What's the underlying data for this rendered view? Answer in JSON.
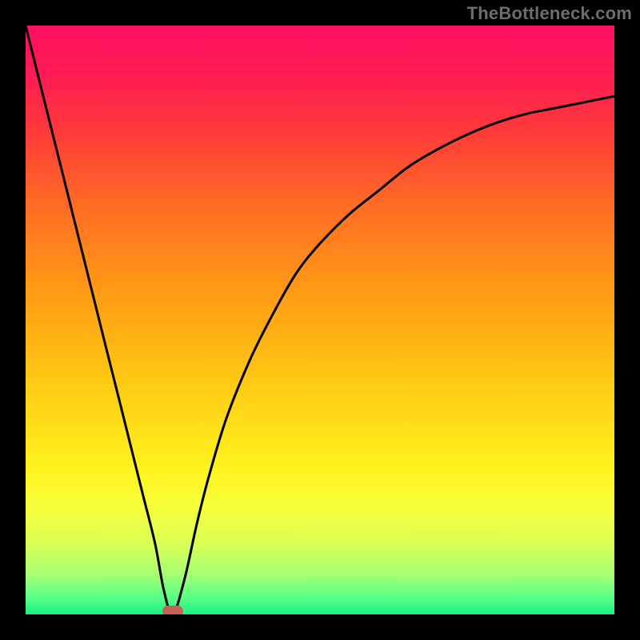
{
  "watermark": "TheBottleneck.com",
  "chart_data": {
    "type": "line",
    "title": "",
    "xlabel": "",
    "ylabel": "",
    "xlim": [
      0,
      100
    ],
    "ylim": [
      0,
      100
    ],
    "legend": false,
    "grid": false,
    "background_gradient_stops": [
      {
        "offset": 0.0,
        "color": "#ff1060"
      },
      {
        "offset": 0.08,
        "color": "#ff1a55"
      },
      {
        "offset": 0.18,
        "color": "#ff3a3a"
      },
      {
        "offset": 0.3,
        "color": "#ff6a25"
      },
      {
        "offset": 0.45,
        "color": "#ff9a15"
      },
      {
        "offset": 0.6,
        "color": "#ffc814"
      },
      {
        "offset": 0.75,
        "color": "#fff21e"
      },
      {
        "offset": 0.82,
        "color": "#f7ff3c"
      },
      {
        "offset": 0.88,
        "color": "#d9ff56"
      },
      {
        "offset": 0.93,
        "color": "#a8ff70"
      },
      {
        "offset": 0.97,
        "color": "#5cff86"
      },
      {
        "offset": 1.0,
        "color": "#18f285"
      }
    ],
    "series": [
      {
        "name": "bottleneck-curve",
        "color": "#000000",
        "x": [
          0,
          2,
          4,
          6,
          8,
          10,
          12,
          14,
          16,
          18,
          20,
          22,
          23.5,
          25,
          27,
          29,
          31,
          34,
          38,
          42,
          46,
          50,
          55,
          60,
          65,
          70,
          75,
          80,
          85,
          90,
          95,
          100
        ],
        "values": [
          100,
          92,
          84,
          76,
          68,
          60,
          52,
          44,
          36,
          28,
          20,
          12,
          4,
          0,
          6,
          15,
          23,
          33,
          43,
          51,
          58,
          63,
          68,
          72,
          76,
          79,
          81.5,
          83.5,
          85,
          86,
          87,
          88
        ]
      }
    ],
    "marker": {
      "x": 25,
      "y": 0.5,
      "color": "#c76058"
    }
  }
}
